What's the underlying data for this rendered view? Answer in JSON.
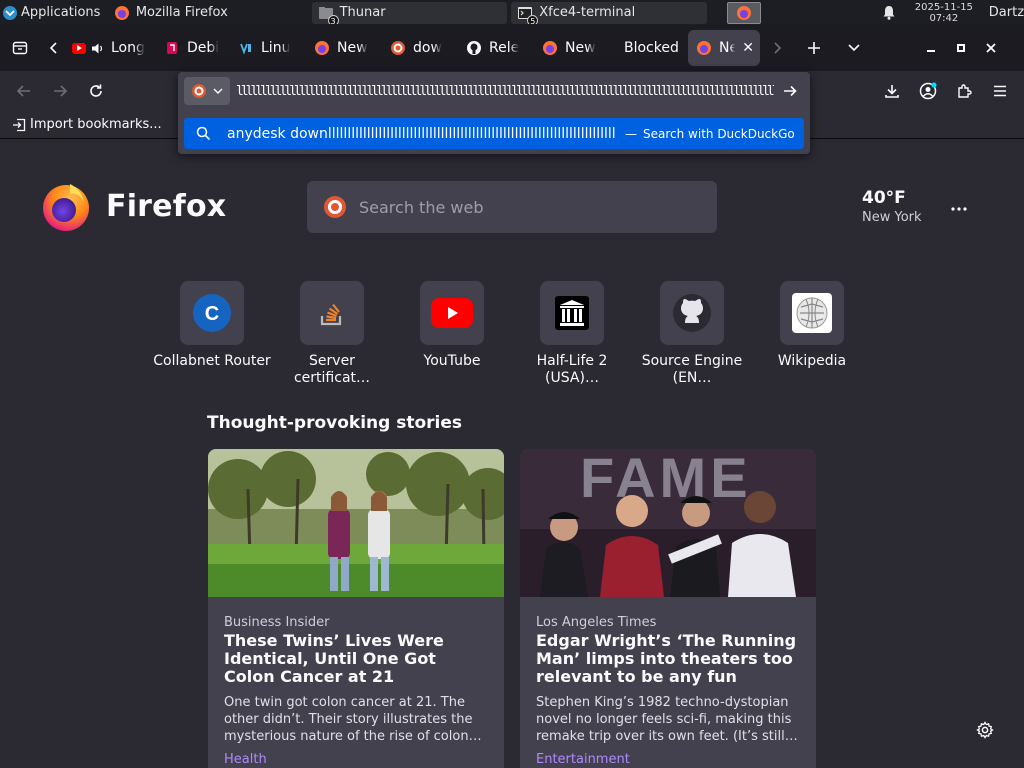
{
  "panel": {
    "apps_label": "Applications",
    "tasks": [
      {
        "label": "Mozilla Firefox"
      },
      {
        "label": "Thunar",
        "badge": "3"
      },
      {
        "label": "Xfce4-terminal",
        "badge": "5"
      }
    ],
    "clock_date": "2025-11-15",
    "clock_time": "07:42",
    "user": "Dartz"
  },
  "tabs": [
    {
      "label": "Long"
    },
    {
      "label": "Debi"
    },
    {
      "label": "Linu"
    },
    {
      "label": "New"
    },
    {
      "label": "dow"
    },
    {
      "label": "Rele"
    },
    {
      "label": "New"
    },
    {
      "label": "Blocked"
    },
    {
      "label": "Ne",
      "active": true
    }
  ],
  "urlbar": {
    "value": "llllllllllllllllllllllllllllllllllllllllllllllllllllllllllllllllllllllllllllllllllllllllllllllllllllllllllllllllllll",
    "suggestion_text": "anydesk downllllllllllllllllllllllllllllllllllllllllllllllllllllllllllllllllllllllllllllllll",
    "suggestion_dash": "—",
    "suggestion_action": "Search with DuckDuckGo"
  },
  "bookmarks": {
    "import_label": "Import bookmarks..."
  },
  "newtab": {
    "logo_text": "Firefox",
    "search_placeholder": "Search the web",
    "weather_temp": "40°F",
    "weather_location": "New York",
    "sites": [
      {
        "label": "Collabnet Router",
        "letter": "C"
      },
      {
        "label": "Server certificat…"
      },
      {
        "label": "YouTube"
      },
      {
        "label": "Half-Life 2 (USA)…"
      },
      {
        "label": "Source Engine (EN…"
      },
      {
        "label": "Wikipedia"
      }
    ],
    "stories_heading": "Thought-provoking stories",
    "stories": [
      {
        "source": "Business Insider",
        "title": "These Twins’ Lives Were Identical, Until One Got Colon Cancer at 21",
        "description": "One twin got colon cancer at 21. The other didn’t. Their story illustrates the mysterious nature of the rise of colon…",
        "category": "Health"
      },
      {
        "source": "Los Angeles Times",
        "title": "Edgar Wright’s ‘The Running Man’ limps into theaters too relevant to be any fun",
        "description": "Stephen King’s 1982 techno-dystopian novel no longer feels sci-fi, making this remake trip over its own feet. (It’s still…",
        "category": "Entertainment",
        "image_text": "FAME"
      }
    ]
  },
  "colors": {
    "accent": "#0061e0",
    "toolbar": "#2b2a33",
    "tabstrip": "#1c1b22",
    "field": "#42414d",
    "category": "#b088ff"
  }
}
